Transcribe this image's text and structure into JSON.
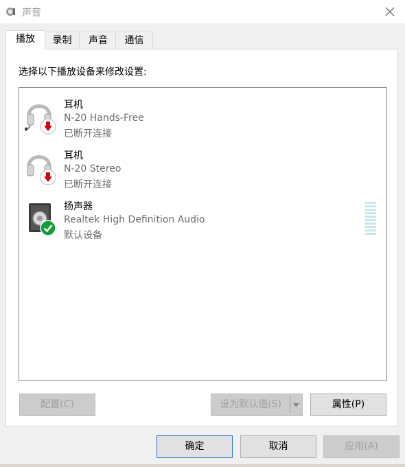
{
  "window": {
    "title": "声音"
  },
  "tabs": [
    {
      "label": "播放",
      "active": true
    },
    {
      "label": "录制",
      "active": false
    },
    {
      "label": "声音",
      "active": false
    },
    {
      "label": "通信",
      "active": false
    }
  ],
  "panel": {
    "instruction": "选择以下播放设备来修改设置:"
  },
  "devices": [
    {
      "name": "耳机",
      "description": "N-20 Hands-Free",
      "status": "已断开连接",
      "icon": "headset-icon",
      "badge": "disconnected-arrow-icon"
    },
    {
      "name": "耳机",
      "description": "N-20 Stereo",
      "status": "已断开连接",
      "icon": "headphones-icon",
      "badge": "disconnected-arrow-icon"
    },
    {
      "name": "扬声器",
      "description": "Realtek High Definition Audio",
      "status": "默认设备",
      "icon": "speaker-icon",
      "badge": "default-check-icon"
    }
  ],
  "buttons": {
    "configure": "配置(C)",
    "set_default": "设为默认值(S)",
    "properties": "属性(P)",
    "ok": "确定",
    "cancel": "取消",
    "apply": "应用(A)"
  },
  "colors": {
    "disconnected_badge": "#d0021b",
    "default_badge": "#109d3a",
    "vu_meter": "#c8e6f0",
    "accent_border": "#2f75c9"
  }
}
